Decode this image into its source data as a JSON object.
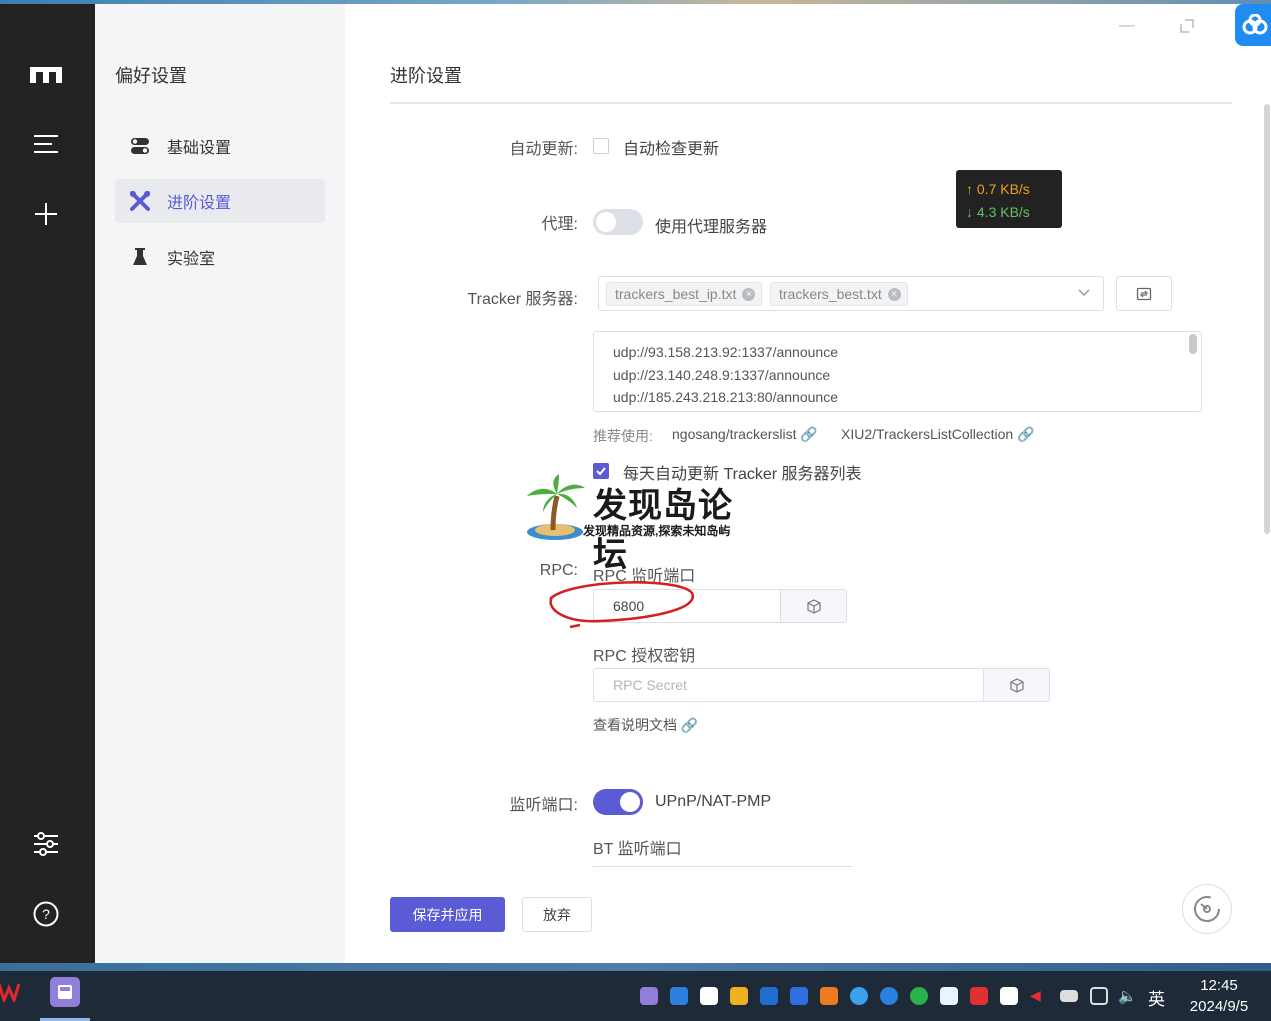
{
  "window": {
    "sidebar_title": "偏好设置",
    "menu": [
      {
        "label": "基础设置",
        "icon": "toggles-icon"
      },
      {
        "label": "进阶设置",
        "icon": "tools-icon"
      },
      {
        "label": "实验室",
        "icon": "flask-icon"
      }
    ],
    "active_menu": "进阶设置"
  },
  "page": {
    "title": "进阶设置",
    "auto_update": {
      "label": "自动更新:",
      "checkbox_label": "自动检查更新",
      "checked": false
    },
    "proxy": {
      "label": "代理:",
      "switch_label": "使用代理服务器",
      "on": false
    },
    "speed": {
      "upload": "↑ 0.7 KB/s",
      "download": "↓ 4.3 KB/s"
    },
    "tracker": {
      "label": "Tracker 服务器:",
      "tags": [
        "trackers_best_ip.txt",
        "trackers_best.txt"
      ],
      "list": [
        "udp://93.158.213.92:1337/announce",
        "udp://23.140.248.9:1337/announce",
        "udp://185.243.218.213:80/announce"
      ],
      "recommend_label": "推荐使用:",
      "recommend_links": [
        "ngosang/trackerslist",
        "XIU2/TrackersListCollection"
      ],
      "daily_update_label": "每天自动更新 Tracker 服务器列表",
      "daily_update_checked": true
    },
    "watermark": {
      "title": "发现岛论坛",
      "subtitle": "发现精品资源,探索未知岛屿"
    },
    "rpc": {
      "label": "RPC:",
      "port_label": "RPC 监听端口",
      "port_value": "6800",
      "secret_label": "RPC 授权密钥",
      "secret_placeholder": "RPC Secret",
      "docs_link": "查看说明文档"
    },
    "listen": {
      "label": "监听端口:",
      "upnp_label": "UPnP/NAT-PMP",
      "upnp_on": true,
      "bt_port_label": "BT 监听端口"
    },
    "buttons": {
      "save": "保存并应用",
      "discard": "放弃"
    }
  },
  "taskbar": {
    "ime": "英",
    "time": "12:45",
    "date": "2024/9/5"
  },
  "colors": {
    "accent": "#5b5bd6",
    "nav_bg": "#232323",
    "annotation": "#d42020"
  }
}
